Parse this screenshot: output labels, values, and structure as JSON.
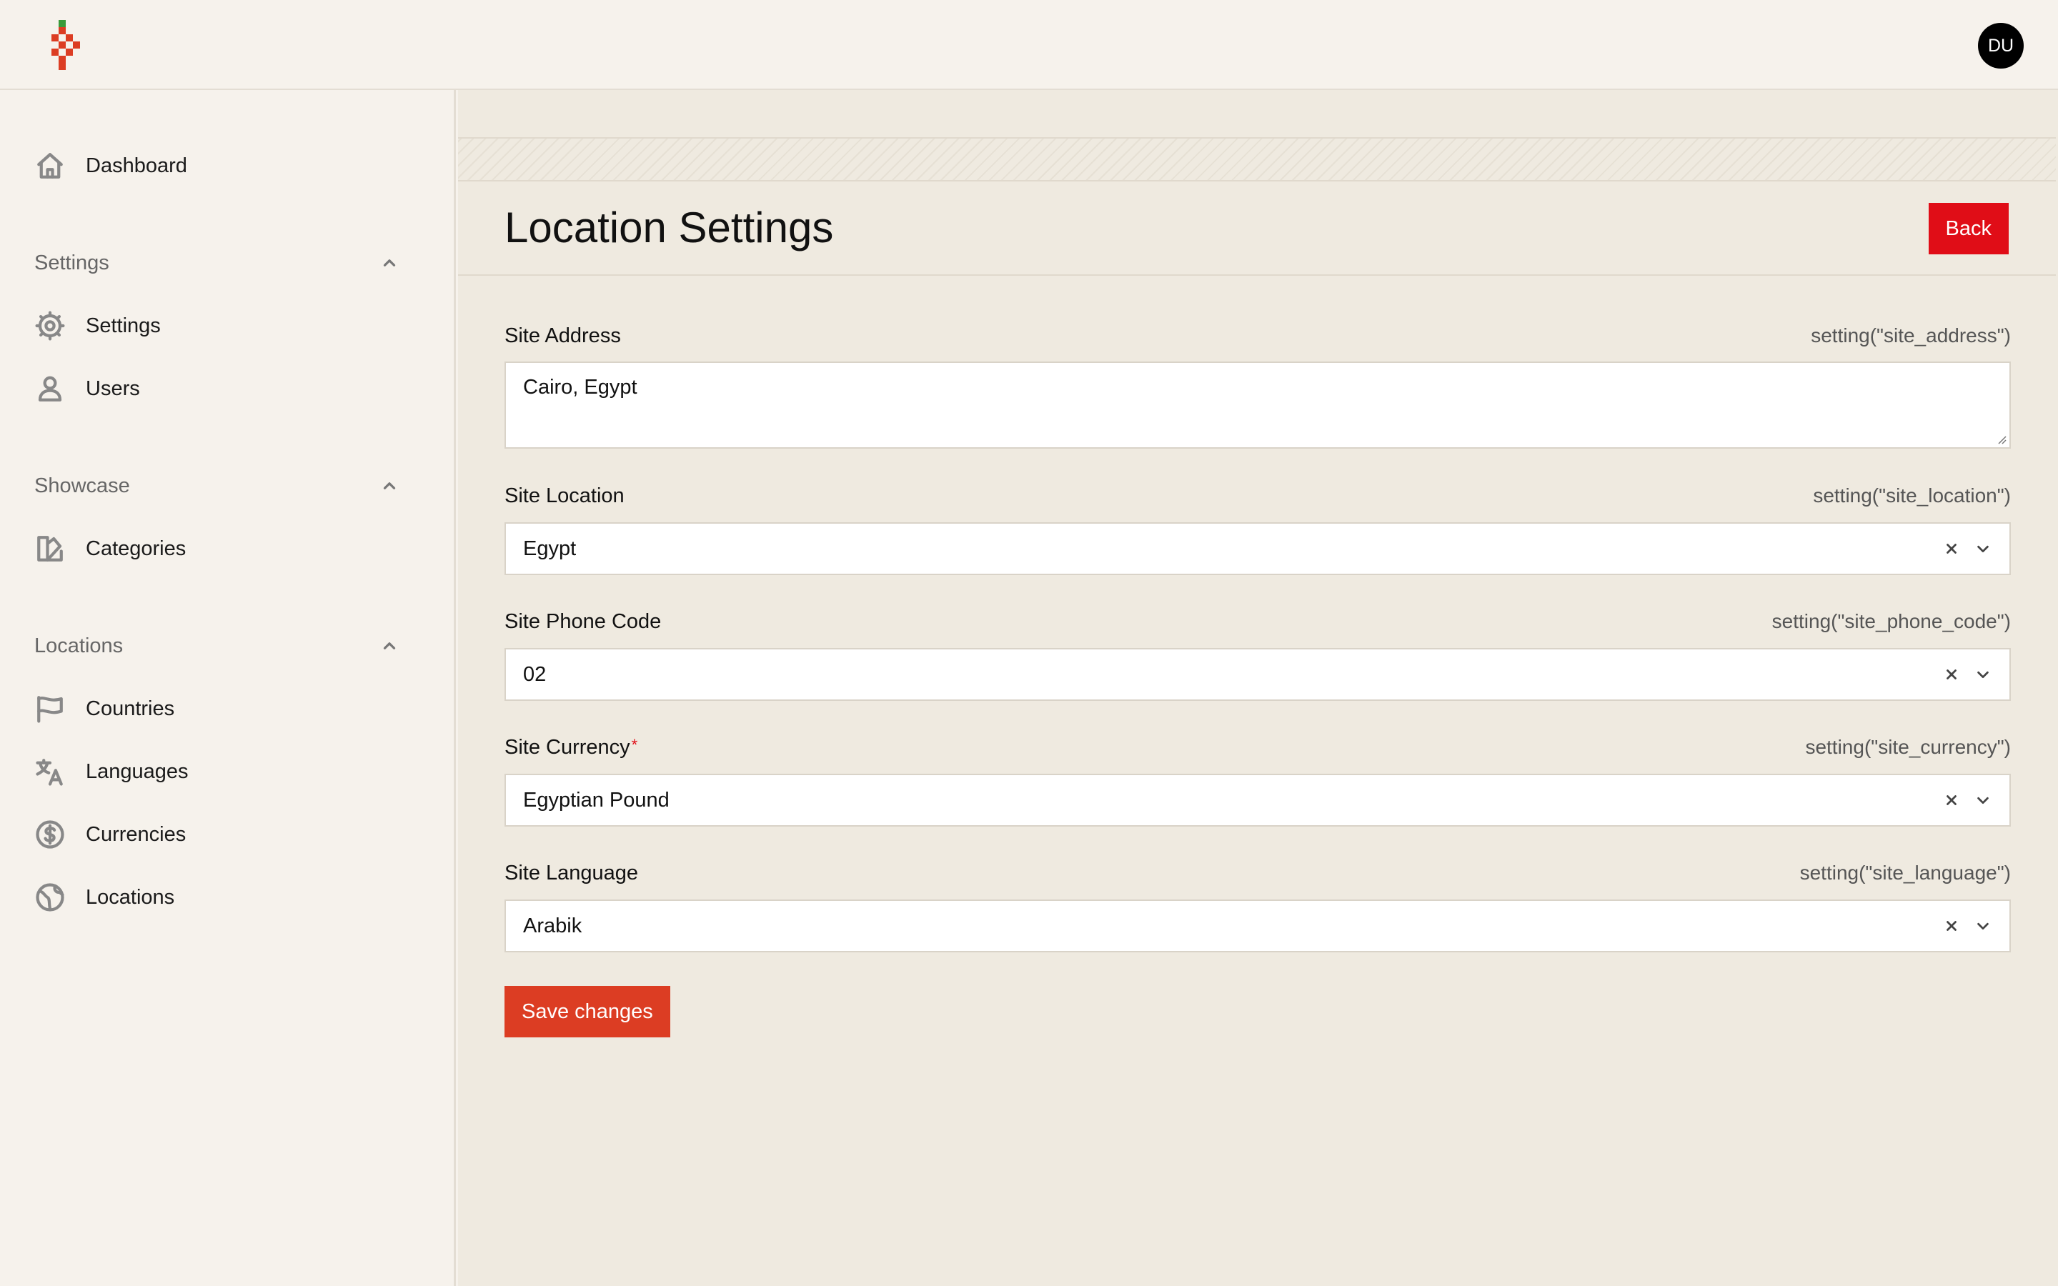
{
  "header": {
    "avatar_initials": "DU"
  },
  "sidebar": {
    "dashboard": {
      "label": "Dashboard",
      "icon": "home-icon"
    },
    "groups": [
      {
        "label": "Settings",
        "items": [
          {
            "label": "Settings",
            "icon": "gear-icon"
          },
          {
            "label": "Users",
            "icon": "user-icon"
          }
        ]
      },
      {
        "label": "Showcase",
        "items": [
          {
            "label": "Categories",
            "icon": "swatch-icon"
          }
        ]
      },
      {
        "label": "Locations",
        "items": [
          {
            "label": "Countries",
            "icon": "flag-icon"
          },
          {
            "label": "Languages",
            "icon": "translate-icon"
          },
          {
            "label": "Currencies",
            "icon": "dollar-icon"
          },
          {
            "label": "Locations",
            "icon": "globe-icon"
          }
        ]
      }
    ]
  },
  "main": {
    "title": "Location Settings",
    "back_label": "Back",
    "fields": [
      {
        "label": "Site Address",
        "hint": "setting(\"site_address\")",
        "value": "Cairo, Egypt",
        "type": "textarea",
        "required": false
      },
      {
        "label": "Site Location",
        "hint": "setting(\"site_location\")",
        "value": "Egypt",
        "type": "select",
        "required": false
      },
      {
        "label": "Site Phone Code",
        "hint": "setting(\"site_phone_code\")",
        "value": "02",
        "type": "select",
        "required": false
      },
      {
        "label": "Site Currency",
        "hint": "setting(\"site_currency\")",
        "value": "Egyptian Pound",
        "type": "select",
        "required": true,
        "required_mark": "*"
      },
      {
        "label": "Site Language",
        "hint": "setting(\"site_language\")",
        "value": "Arabik",
        "type": "select",
        "required": false
      }
    ],
    "save_label": "Save changes"
  },
  "colors": {
    "background": "#f6f2ec",
    "content_background": "#efeae0",
    "back_button": "#e00d17",
    "save_button": "#dc3d23",
    "avatar": "#000000"
  }
}
